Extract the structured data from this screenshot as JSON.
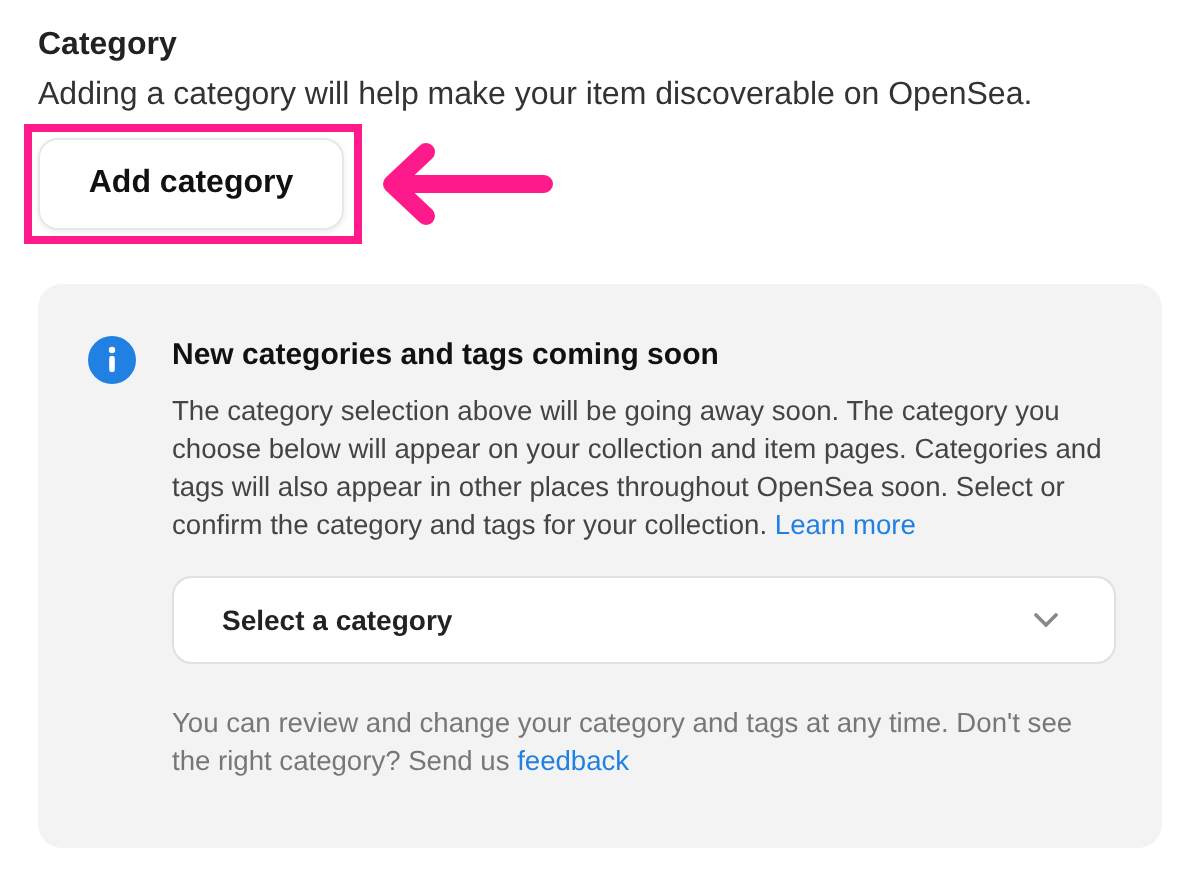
{
  "section": {
    "title": "Category",
    "description": "Adding a category will help make your item discoverable on OpenSea.",
    "button": "Add category"
  },
  "notice": {
    "title": "New categories and tags coming soon",
    "body": "The category selection above will be going away soon. The category you choose below will appear on your collection and item pages. Categories and tags will also appear in other places throughout OpenSea soon. Select or confirm the category and tags for your collection.",
    "link": "Learn more",
    "select": {
      "placeholder": "Select a category"
    },
    "footer": "You can review and change your category and tags at any time. Don't see the right category? Send us",
    "footer_link": "feedback"
  }
}
